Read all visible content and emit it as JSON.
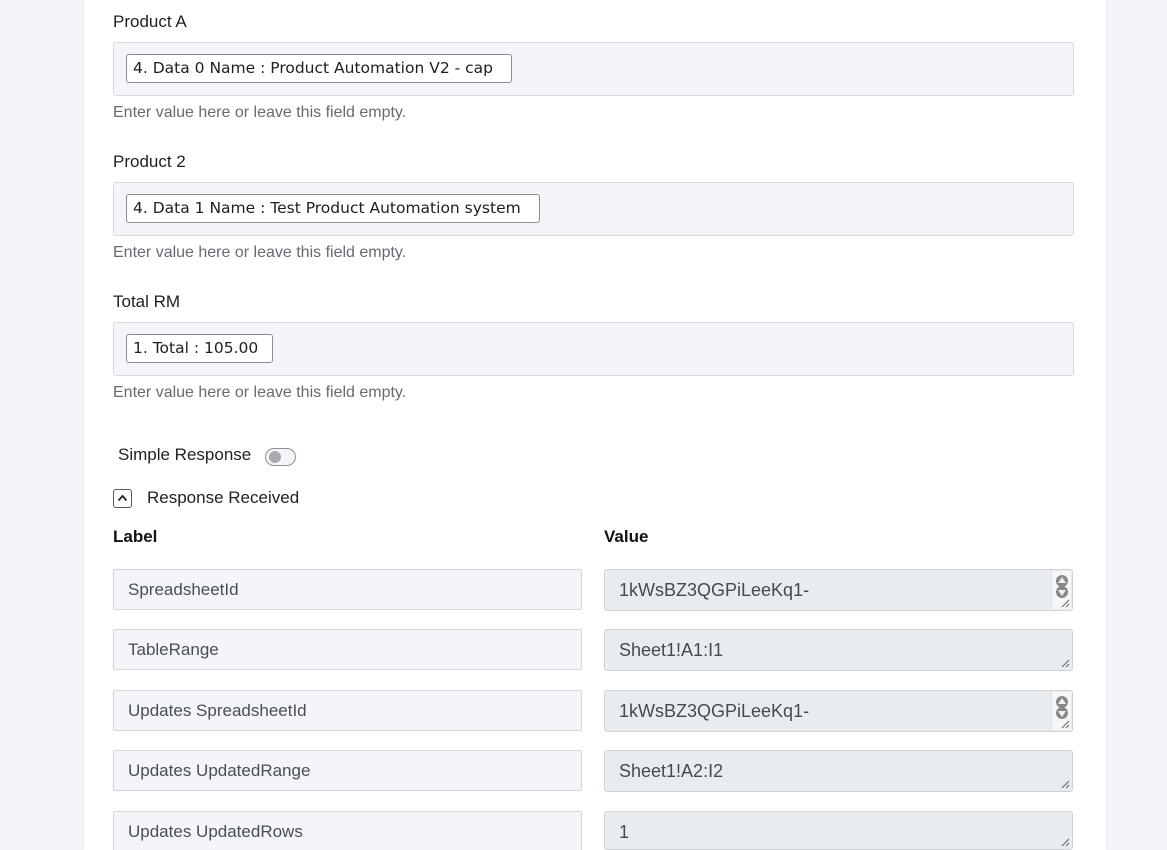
{
  "fields": [
    {
      "label": "Product A",
      "chip": "4. Data 0 Name : Product Automation V2 - cap",
      "help": "Enter value here or leave this field empty."
    },
    {
      "label": "Product 2",
      "chip": "4. Data 1 Name : Test Product Automation system",
      "help": "Enter value here or leave this field empty."
    },
    {
      "label": "Total RM",
      "chip": "1. Total : 105.00",
      "help": "Enter value here or leave this field empty."
    }
  ],
  "simple_response": {
    "label": "Simple Response",
    "enabled": false
  },
  "response_received": {
    "label": "Response Received",
    "expanded": true
  },
  "table": {
    "label_header": "Label",
    "value_header": "Value",
    "rows": [
      {
        "label": "SpreadsheetId",
        "value": "1kWsBZ3QGPiLeeKq1-"
      },
      {
        "label": "TableRange",
        "value": "Sheet1!A1:I1"
      },
      {
        "label": "Updates SpreadsheetId",
        "value": "1kWsBZ3QGPiLeeKq1-"
      },
      {
        "label": "Updates UpdatedRange",
        "value": "Sheet1!A2:I2"
      },
      {
        "label": "Updates UpdatedRows",
        "value": "1"
      }
    ]
  }
}
